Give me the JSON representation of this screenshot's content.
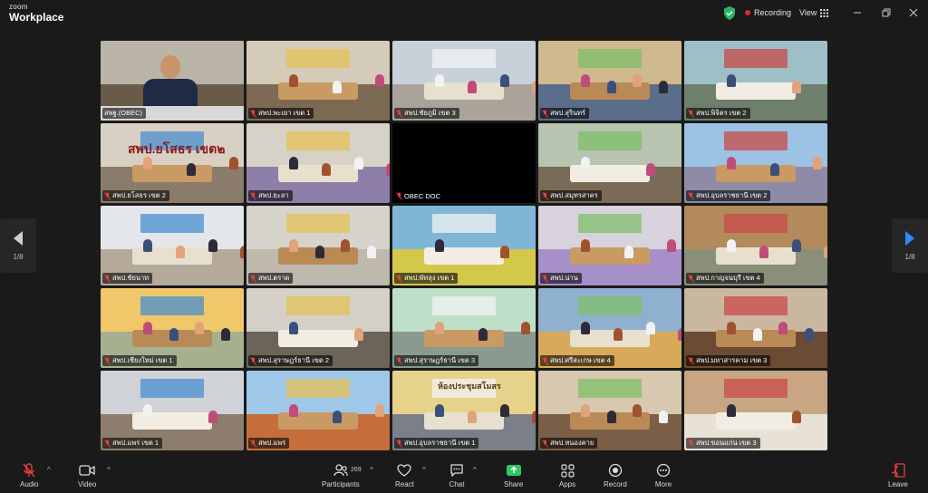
{
  "app": {
    "brand_top": "zoom",
    "brand_bottom": "Workplace"
  },
  "status": {
    "recording_label": "Recording",
    "view_label": "View"
  },
  "pager": {
    "left_page": "1/8",
    "right_page": "1/8"
  },
  "grid_tiles": [
    {
      "name": "สพฐ.(OBEC)",
      "active": true
    },
    {
      "name": "สพป.พะเยา เขต 1"
    },
    {
      "name": "สพป.ชัยภูมิ เขต 3"
    },
    {
      "name": "สพป.สุรินทร์"
    },
    {
      "name": "สพป.พิจิตร เขต 2"
    },
    {
      "name": "สพป.ยโสธร เขต 2",
      "wall_text": "สพป.ยโสธร เขต๒"
    },
    {
      "name": "สพป.ยะลา"
    },
    {
      "name": "OBEC DOC",
      "blank": true
    },
    {
      "name": "สพป.สมุทรสาคร"
    },
    {
      "name": "สพป.อุบลราชธานี เขต 2"
    },
    {
      "name": "สพป.ชัยนาท"
    },
    {
      "name": "สพป.ตราด"
    },
    {
      "name": "สพป.พัทลุง เขต 1"
    },
    {
      "name": "สพป.น่าน"
    },
    {
      "name": "สพป.กาญจนบุรี เขต 4"
    },
    {
      "name": "สพป.เชียงใหม่ เขต 1"
    },
    {
      "name": "สพป.สุราษฎร์ธานี เขต 2"
    },
    {
      "name": "สพป.สุราษฎร์ธานี เขต 3"
    },
    {
      "name": "สพป.ศรีสะเกษ เขต 4"
    },
    {
      "name": "สพป.มหาสารคาม เขต 3"
    },
    {
      "name": "สพป.แพร่ เขต 1"
    },
    {
      "name": "สพป.แพร่"
    },
    {
      "name": "สพป.อุบลราชธานี เขต 1",
      "wall_text": "ห้องประชุมสโมสร"
    },
    {
      "name": "สพป.หนองคาย"
    },
    {
      "name": "สพป.ขอนแก่น เขต 3"
    }
  ],
  "toolbar": {
    "audio": "Audio",
    "video": "Video",
    "participants": "Participants",
    "participants_count": "269",
    "react": "React",
    "chat": "Chat",
    "share": "Share",
    "apps": "Apps",
    "record": "Record",
    "more": "More",
    "leave": "Leave"
  },
  "colors": {
    "active_border": "#3fd17a",
    "recording_dot": "#e02828",
    "share_green": "#2ec866",
    "leave_red": "#e8413b"
  }
}
